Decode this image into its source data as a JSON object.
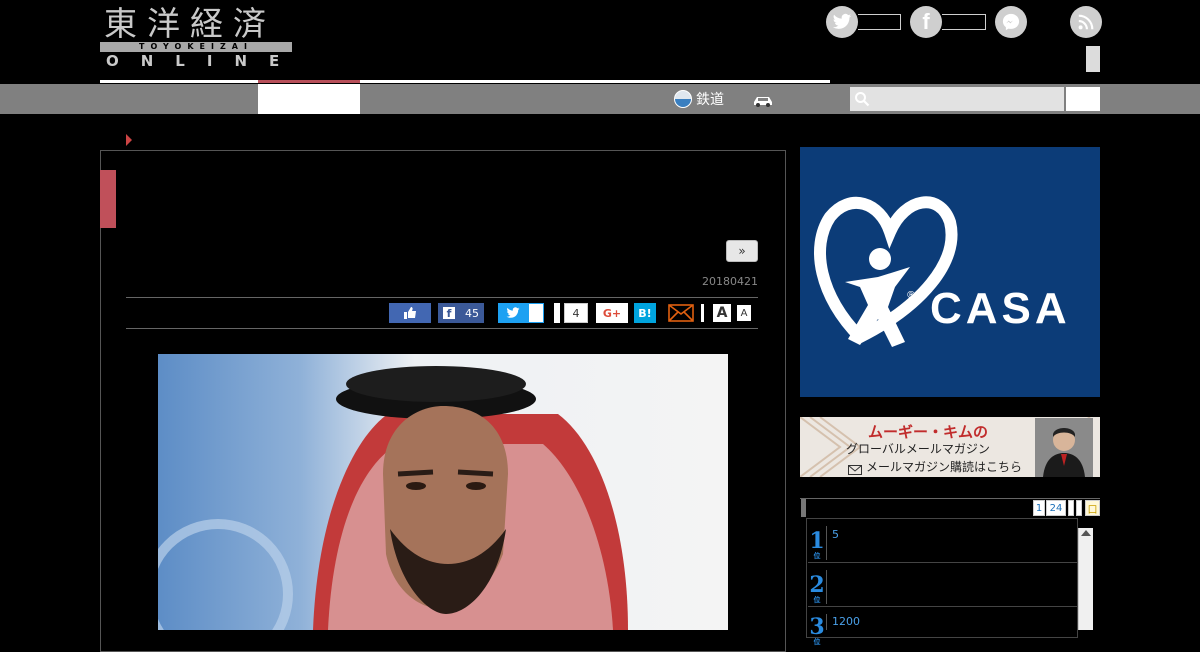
{
  "header": {
    "logo_kanji": "東洋経済",
    "logo_romaji": "TOYOKEIZAI",
    "logo_online": "ONLINE"
  },
  "nav": {
    "railway_label": "鉄道"
  },
  "article": {
    "next_label": "»",
    "date": "20180421"
  },
  "share": {
    "facebook_count": "45",
    "twitter_count": "4",
    "gplus_label": "G+",
    "hatena_label": "B!",
    "font_large": "A",
    "font_small": "A"
  },
  "sidebar": {
    "ad_casa": {
      "brand": "CASA",
      "reg": "®",
      "bg_color": "#0c3c78"
    },
    "banner": {
      "title": "ムーギー・キムの",
      "subtitle": "グローバルメールマガジン",
      "cta": "メールマガジン購読はこちら"
    },
    "ranking": {
      "tab1": "1",
      "tab2": "24",
      "tab_last": "口",
      "items": [
        {
          "rank": "1",
          "rank_suffix": "位",
          "text": "5"
        },
        {
          "rank": "2",
          "rank_suffix": "位",
          "text": ""
        },
        {
          "rank": "3",
          "rank_suffix": "位",
          "text": "1200"
        }
      ]
    }
  },
  "colors": {
    "accent_red": "#c0505a",
    "facebook_blue": "#3b5998",
    "twitter_blue": "#1da1f2",
    "nav_gray": "#808080"
  }
}
